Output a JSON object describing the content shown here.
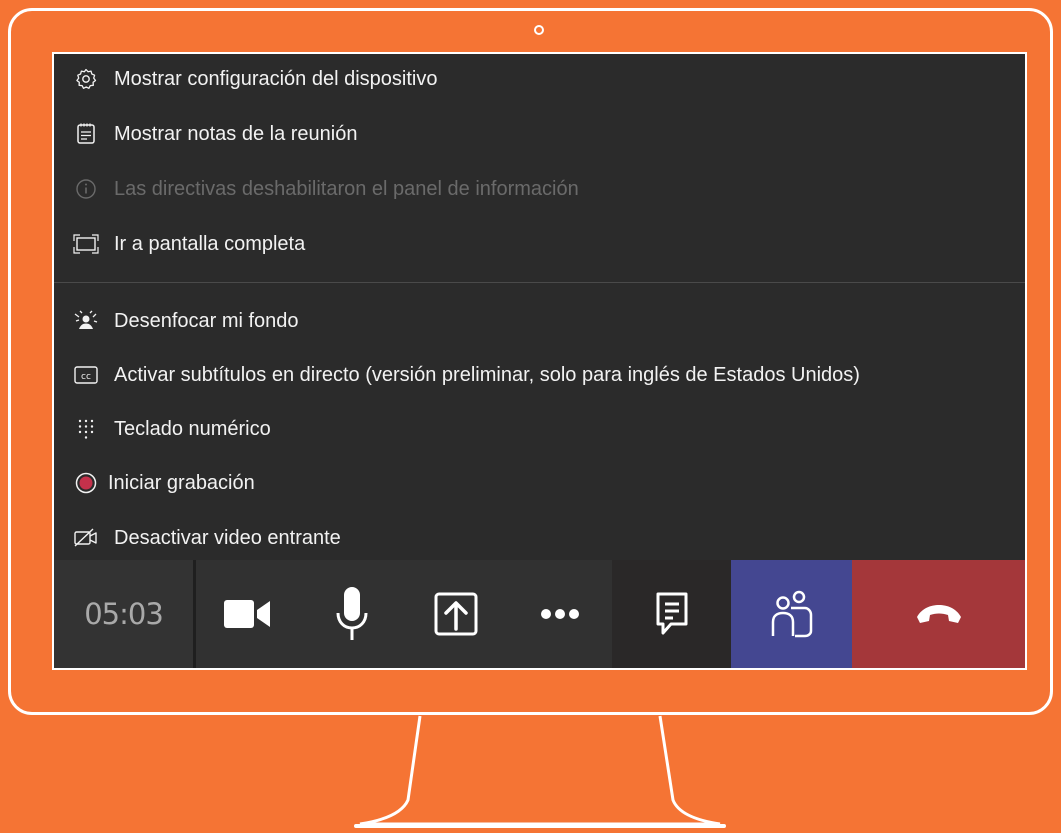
{
  "menu": {
    "items": [
      {
        "label": "Mostrar configuración del dispositivo",
        "icon": "gear-icon",
        "disabled": false
      },
      {
        "label": "Mostrar notas de la reunión",
        "icon": "notes-icon",
        "disabled": false
      },
      {
        "label": "Las directivas deshabilitaron el panel de información",
        "icon": "info-icon",
        "disabled": true
      },
      {
        "label": "Ir a pantalla completa",
        "icon": "fullscreen-icon",
        "disabled": false
      },
      {
        "label": "Desenfocar mi fondo",
        "icon": "blur-background-icon",
        "disabled": false
      },
      {
        "label": "Activar subtítulos en directo (versión preliminar, solo para inglés de Estados Unidos)",
        "icon": "closed-captions-icon",
        "disabled": false
      },
      {
        "label": "Teclado numérico",
        "icon": "dialpad-icon",
        "disabled": false
      },
      {
        "label": "Iniciar grabación",
        "icon": "record-icon",
        "disabled": false
      },
      {
        "label": "Desactivar video entrante",
        "icon": "video-off-icon",
        "disabled": false
      }
    ]
  },
  "toolbar": {
    "timer": "05:03",
    "buttons": [
      "video-camera-icon",
      "microphone-icon",
      "share-screen-icon",
      "more-options-icon",
      "chat-icon",
      "participants-icon",
      "hang-up-icon"
    ]
  },
  "colors": {
    "background": "#F57434",
    "screen": "#2b2b2b",
    "people_button": "#444791",
    "hangup_button": "#A4373A",
    "record": "#C4314B"
  }
}
